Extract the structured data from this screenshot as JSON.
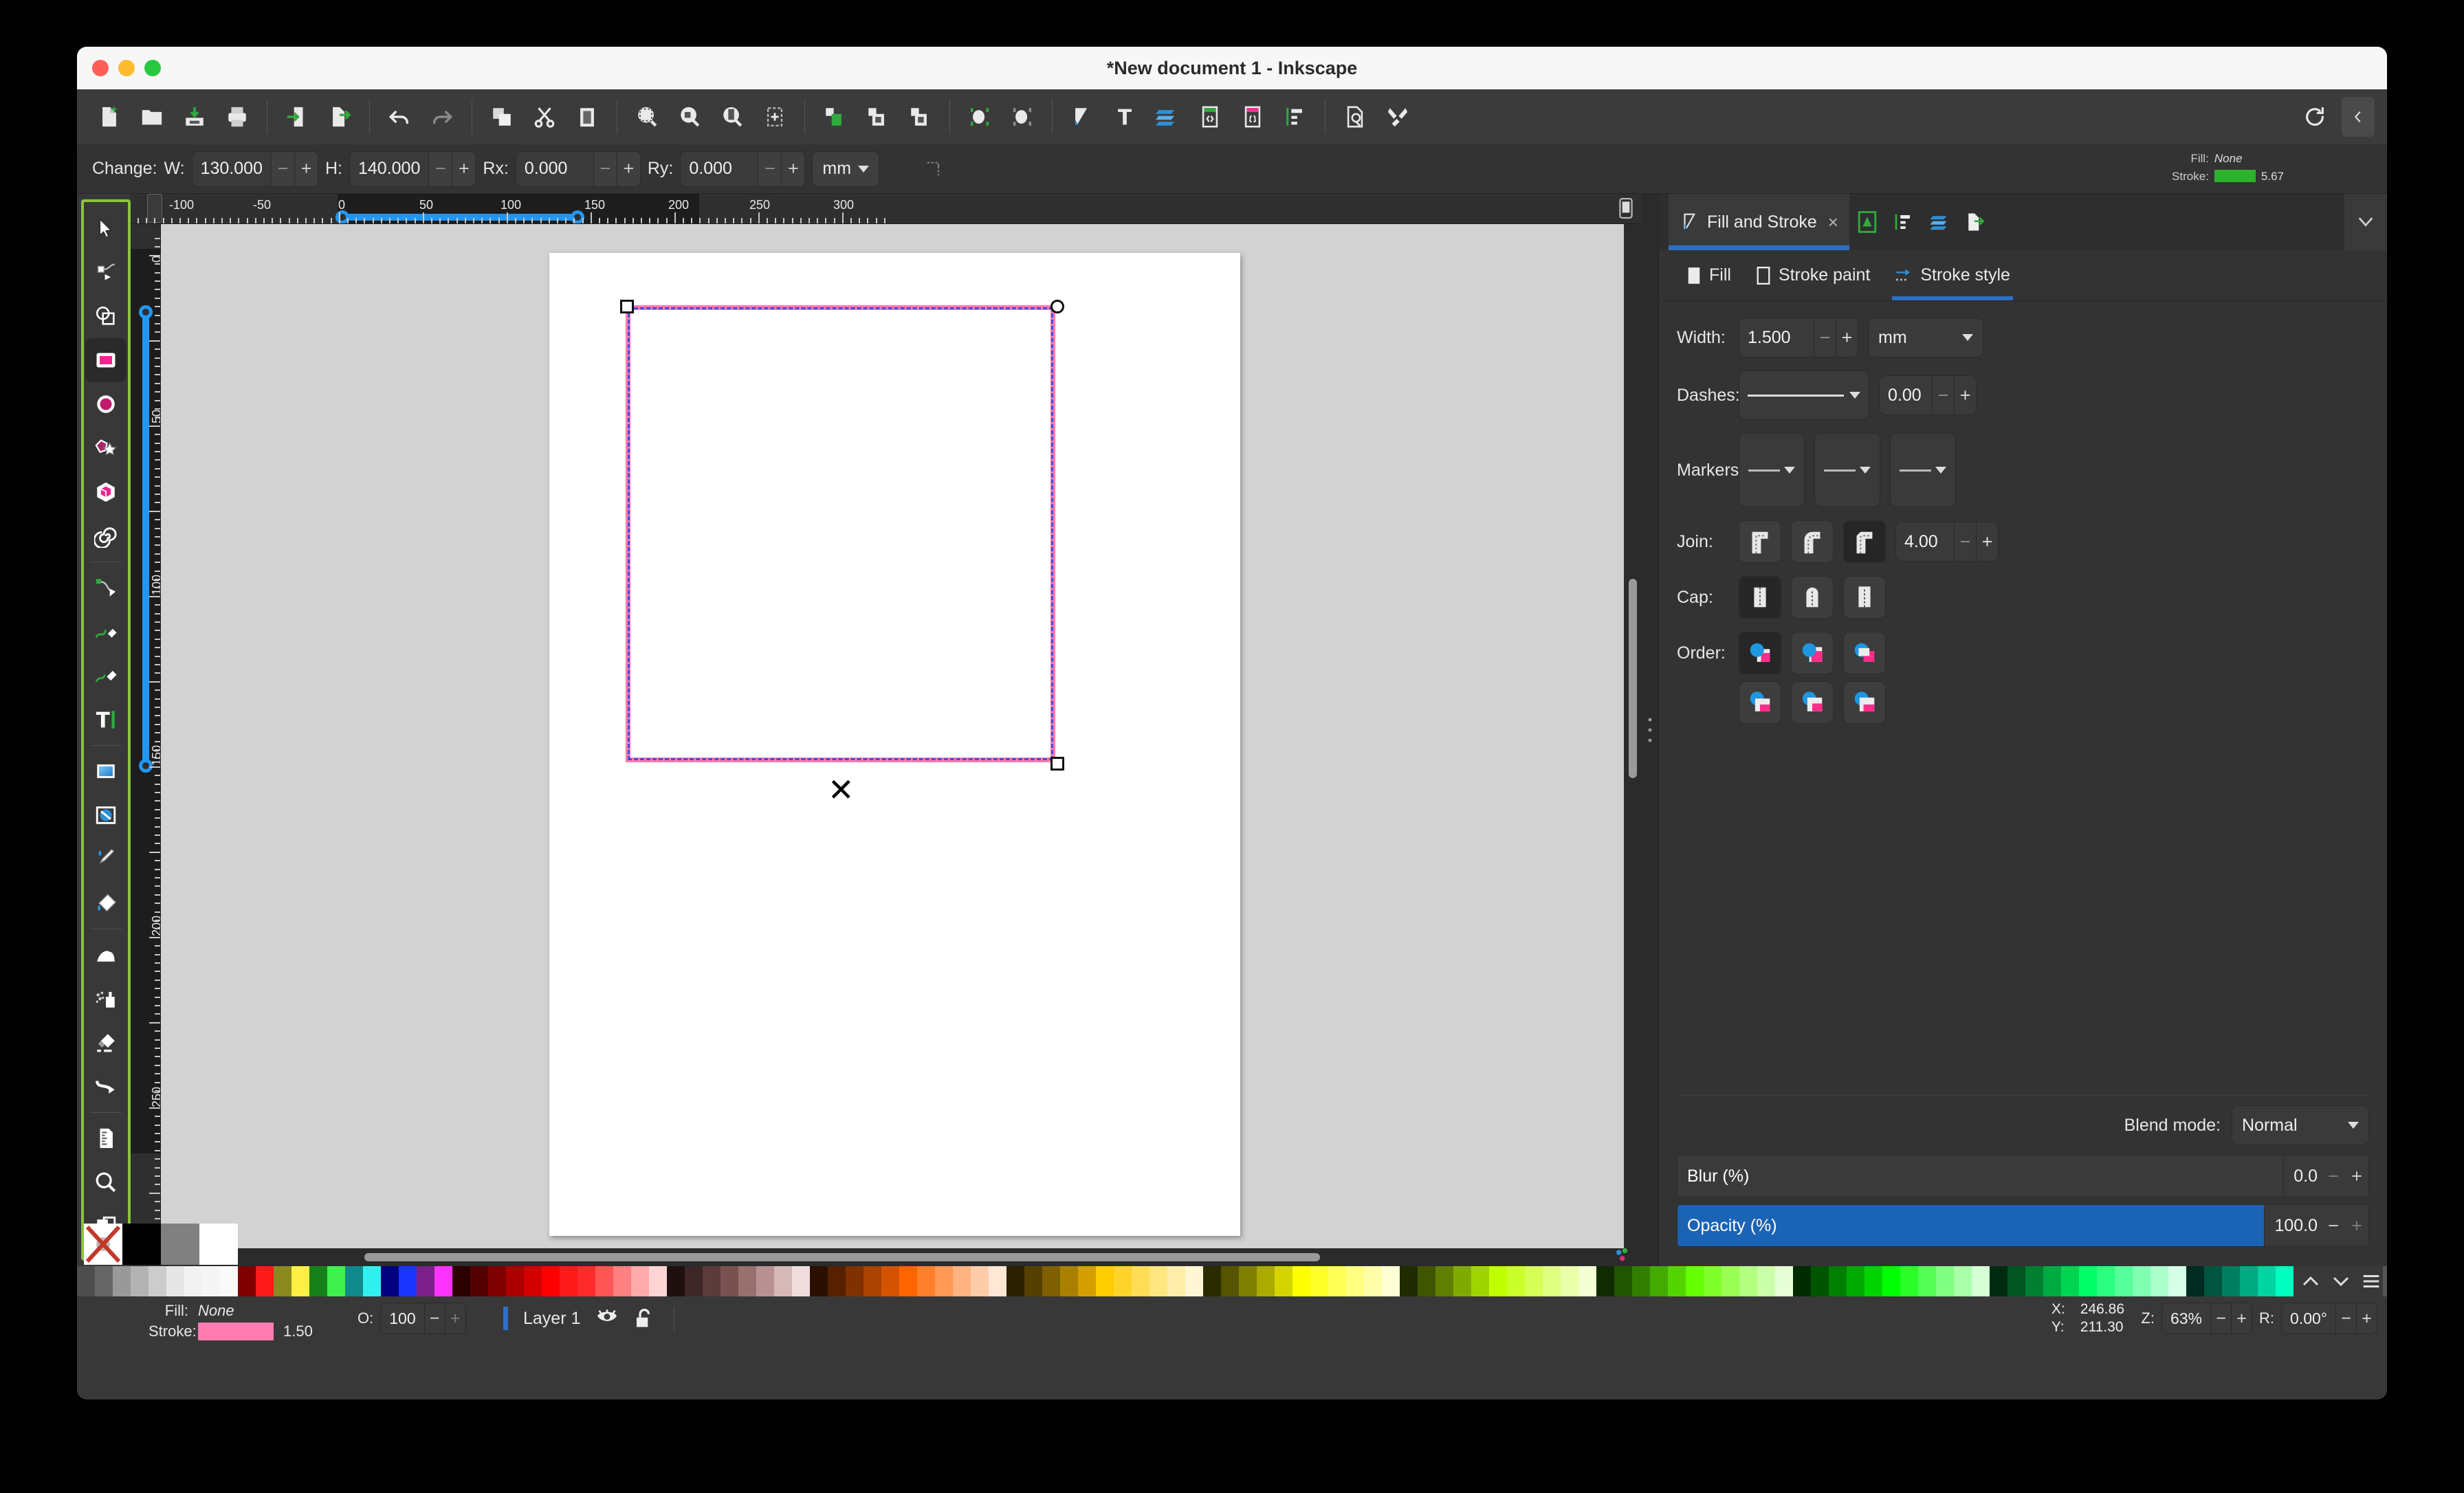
{
  "window": {
    "title": "*New document 1 - Inkscape",
    "traffic_lights": [
      "close",
      "minimize",
      "maximize"
    ]
  },
  "toolbar_main": {
    "buttons": [
      {
        "name": "new-document",
        "icon": "new-doc-icon"
      },
      {
        "name": "open-document",
        "icon": "open-folder-icon"
      },
      {
        "name": "save-document",
        "icon": "save-icon"
      },
      {
        "name": "print-document",
        "icon": "print-icon"
      },
      {
        "name": "import",
        "icon": "import-icon"
      },
      {
        "name": "export",
        "icon": "export-icon"
      },
      {
        "name": "undo",
        "icon": "undo-icon"
      },
      {
        "name": "redo",
        "icon": "redo-icon"
      },
      {
        "name": "copy",
        "icon": "copy-icon"
      },
      {
        "name": "cut",
        "icon": "scissors-icon"
      },
      {
        "name": "paste",
        "icon": "clipboard-icon"
      },
      {
        "name": "zoom-selection",
        "icon": "zoom-selection-icon"
      },
      {
        "name": "zoom-drawing",
        "icon": "zoom-drawing-icon"
      },
      {
        "name": "zoom-page",
        "icon": "zoom-page-icon"
      },
      {
        "name": "zoom-center-page",
        "icon": "zoom-center-icon"
      },
      {
        "name": "duplicate-group",
        "icon": "group-icon"
      },
      {
        "name": "group-objects",
        "icon": "group-objects-icon"
      },
      {
        "name": "ungroup-objects",
        "icon": "ungroup-objects-icon"
      },
      {
        "name": "clip-set",
        "icon": "clip-icon"
      },
      {
        "name": "mask-set",
        "icon": "mask-icon"
      },
      {
        "name": "fill-and-stroke-dialog",
        "icon": "fill-stroke-icon"
      },
      {
        "name": "text-and-font-dialog",
        "icon": "text-icon"
      },
      {
        "name": "layers-dialog",
        "icon": "layers-icon"
      },
      {
        "name": "xml-editor",
        "icon": "xml-editor-icon"
      },
      {
        "name": "selectors-dialog",
        "icon": "selectors-icon"
      },
      {
        "name": "objects-dialog",
        "icon": "objects-list-icon"
      },
      {
        "name": "document-properties",
        "icon": "doc-properties-icon"
      },
      {
        "name": "preferences",
        "icon": "preferences-wrench-icon"
      }
    ],
    "reset_label": "reset-icon",
    "collapse_label": "collapse-panel-icon"
  },
  "tool_options": {
    "change_label": "Change:",
    "w_label": "W:",
    "w_value": "130.000",
    "h_label": "H:",
    "h_value": "140.000",
    "rx_label": "Rx:",
    "rx_value": "0.000",
    "ry_label": "Ry:",
    "ry_value": "0.000",
    "unit": "mm",
    "sharp_corners_icon": "make-corners-sharp-icon"
  },
  "indicator_top_right": {
    "fill_label": "Fill:",
    "fill_value": "None",
    "stroke_label": "Stroke:",
    "stroke_color": "#2bb32b",
    "stroke_width": "5.67"
  },
  "toolbox": {
    "tools": [
      {
        "name": "selector-tool",
        "icon": "arrow-cursor-icon",
        "active": false
      },
      {
        "name": "node-tool",
        "icon": "node-editor-icon",
        "active": false
      },
      {
        "name": "boolean-tool",
        "icon": "boolean-ops-icon",
        "active": false
      },
      {
        "name": "rectangle-tool",
        "icon": "rectangle-icon",
        "active": true
      },
      {
        "name": "ellipse-tool",
        "icon": "ellipse-icon",
        "active": false
      },
      {
        "name": "star-tool",
        "icon": "star-polygon-icon",
        "active": false
      },
      {
        "name": "box3d-tool",
        "icon": "cube-3d-icon",
        "active": false
      },
      {
        "name": "spiral-tool",
        "icon": "spiral-icon",
        "active": false
      },
      {
        "name": "pen-tool",
        "icon": "bezier-pen-icon",
        "active": false
      },
      {
        "name": "pencil-tool",
        "icon": "pencil-icon",
        "active": false
      },
      {
        "name": "calligraphy-tool",
        "icon": "calligraphy-brush-icon",
        "active": false
      },
      {
        "name": "text-tool",
        "icon": "text-a-icon",
        "active": false
      },
      {
        "name": "gradient-tool",
        "icon": "gradient-icon",
        "active": false
      },
      {
        "name": "mesh-gradient-tool",
        "icon": "mesh-gradient-icon",
        "active": false
      },
      {
        "name": "dropper-tool",
        "icon": "eyedropper-icon",
        "active": false
      },
      {
        "name": "paint-bucket-tool",
        "icon": "paint-bucket-icon",
        "active": false
      },
      {
        "name": "tweak-tool",
        "icon": "tweak-hand-icon",
        "active": false
      },
      {
        "name": "spray-tool",
        "icon": "spray-can-icon",
        "active": false
      },
      {
        "name": "eraser-tool",
        "icon": "eraser-icon",
        "active": false
      },
      {
        "name": "connector-tool",
        "icon": "connector-arrow-icon",
        "active": false
      },
      {
        "name": "measure-tool",
        "icon": "measure-ruler-icon",
        "active": false
      },
      {
        "name": "zoom-tool",
        "icon": "magnifier-icon",
        "active": false
      },
      {
        "name": "pages-tool",
        "icon": "pages-icon",
        "active": false
      }
    ]
  },
  "rulers": {
    "unit": "mm",
    "horizontal_labels": [
      "-100",
      "-50",
      "0",
      "50",
      "100",
      "150",
      "200",
      "250",
      "300"
    ],
    "vertical_labels": [
      "0",
      "50",
      "100",
      "150",
      "200",
      "250"
    ],
    "selection_span_h": [
      "0",
      "150"
    ],
    "selection_span_v": [
      "0",
      "160"
    ]
  },
  "dock": {
    "tabs": [
      {
        "name": "fill-and-stroke",
        "label": "Fill and Stroke",
        "icon": "fill-stroke-icon",
        "active": true,
        "closable": true
      },
      {
        "name": "symbols",
        "icon": "symbols-icon",
        "active": false
      },
      {
        "name": "objects",
        "icon": "objects-list-icon",
        "active": false
      },
      {
        "name": "layers",
        "icon": "layers-icon",
        "active": false
      },
      {
        "name": "export",
        "icon": "export-icon",
        "active": false
      }
    ],
    "close_label": "×",
    "chevron_icon": "chevron-down-icon",
    "subtabs": [
      {
        "name": "tab-fill",
        "label": "Fill",
        "icon": "fill-square-icon",
        "active": false
      },
      {
        "name": "tab-stroke-paint",
        "label": "Stroke paint",
        "icon": "stroke-paint-icon",
        "active": false
      },
      {
        "name": "tab-stroke-style",
        "label": "Stroke style",
        "icon": "stroke-style-icon",
        "active": true
      }
    ],
    "stroke_style": {
      "width_label": "Width:",
      "width_value": "1.500",
      "width_unit": "mm",
      "dashes_label": "Dashes:",
      "dash_offset": "0.00",
      "markers_label": "Markers:",
      "markers": [
        "none",
        "none",
        "none"
      ],
      "join_label": "Join:",
      "join_options": [
        "miter-join",
        "round-join",
        "bevel-join"
      ],
      "join_selected_index": 2,
      "miter_limit": "4.00",
      "cap_label": "Cap:",
      "cap_options": [
        "butt-cap",
        "round-cap",
        "square-cap"
      ],
      "cap_selected_index": 0,
      "order_label": "Order:",
      "order_options": [
        "fill-stroke-markers",
        "fill-markers-stroke",
        "stroke-fill-markers",
        "stroke-markers-fill",
        "markers-fill-stroke",
        "markers-stroke-fill"
      ],
      "order_selected_index": 0
    },
    "blend_mode_label": "Blend mode:",
    "blend_mode_value": "Normal",
    "blur_label": "Blur (%)",
    "blur_value": "0.0",
    "opacity_label": "Opacity (%)",
    "opacity_value": "100.0",
    "opacity_percent": 100
  },
  "statusbar": {
    "fill_label": "Fill:",
    "fill_value": "None",
    "stroke_label": "Stroke:",
    "stroke_color": "#ff7bb0",
    "stroke_width": "1.50",
    "opacity_label": "O:",
    "opacity_value": "100",
    "layer_name": "Layer 1",
    "layer_visibility_icon": "eye-icon",
    "layer_lock_icon": "unlock-icon",
    "x_label": "X:",
    "x_value": "246.86",
    "y_label": "Y:",
    "y_value": "211.30",
    "zoom_label": "Z:",
    "zoom_value": "63%",
    "rotation_label": "R:",
    "rotation_value": "0.00°",
    "menu_icon": "hamburger-menu-icon",
    "palette_up_icon": "chevron-up-icon",
    "palette_down_icon": "chevron-down-icon",
    "snap_icon": "snap-controls-icon"
  },
  "palette": {
    "quick": [
      "none",
      "#000000",
      "#808080",
      "#ffffff"
    ],
    "colors": [
      "#4d4d4d",
      "#666666",
      "#999999",
      "#b3b3b3",
      "#cccccc",
      "#e6e6e6",
      "#f2f2f2",
      "#f5f5f5",
      "#fafafa",
      "#800000",
      "#ff1a1a",
      "#8a8a1f",
      "#ffee44",
      "#15801a",
      "#3ff04f",
      "#0f8a8a",
      "#33f0f0",
      "#000080",
      "#1a35ff",
      "#7d1f8a",
      "#ff33ff",
      "#2b0000",
      "#550000",
      "#7f0000",
      "#aa0000",
      "#d40000",
      "#ff0000",
      "#ff1a1a",
      "#ff2b2b",
      "#ff5555",
      "#ff8080",
      "#ffaaaa",
      "#ffd4d4",
      "#1f0f0f",
      "#3d2626",
      "#5c3b3b",
      "#7a5151",
      "#997070",
      "#b89292",
      "#d6b8b8",
      "#f0dede",
      "#2b1000",
      "#552100",
      "#7f3200",
      "#aa4200",
      "#d45300",
      "#ff6400",
      "#ff7f2a",
      "#ff9955",
      "#ffb380",
      "#ffccaa",
      "#ffe6d5",
      "#2b2000",
      "#554000",
      "#7f6000",
      "#aa8000",
      "#d4a000",
      "#ffcc00",
      "#ffd42a",
      "#ffdd55",
      "#ffe680",
      "#ffeeaa",
      "#fff6d5",
      "#2b2b00",
      "#555500",
      "#7f7f00",
      "#aaaa00",
      "#d4d400",
      "#ffff00",
      "#ffff2a",
      "#ffff55",
      "#ffff80",
      "#ffffaa",
      "#ffffd5",
      "#202b00",
      "#405500",
      "#607f00",
      "#80aa00",
      "#a0d400",
      "#c0ff00",
      "#caff2a",
      "#d5ff55",
      "#dfff80",
      "#eaffaa",
      "#f4ffd5",
      "#102b00",
      "#215500",
      "#327f00",
      "#42aa00",
      "#53d400",
      "#64ff00",
      "#7fff2a",
      "#99ff55",
      "#b3ff80",
      "#ccffaa",
      "#e6ffd5",
      "#002b00",
      "#005500",
      "#007f00",
      "#00aa00",
      "#00d400",
      "#00ff00",
      "#2aff2a",
      "#55ff55",
      "#80ff80",
      "#aaffaa",
      "#d5ffd5",
      "#002b10",
      "#005521",
      "#007f32",
      "#00aa42",
      "#00d453",
      "#00ff64",
      "#2aff7f",
      "#55ff99",
      "#80ffb3",
      "#aaffcc",
      "#d5ffe6",
      "#002b20",
      "#005540",
      "#007f60",
      "#00aa80",
      "#00d4a0",
      "#00ffc0",
      "#2affca",
      "#55ffd5",
      "#80ffdf",
      "#aaffea",
      "#3a3a3a",
      "#555555",
      "#707070",
      "#8b8b8b",
      "#a6a6a6",
      "#c1c1c1",
      "#dcdcdc",
      "#1a1a00",
      "#333300",
      "#4d4d00",
      "#666600",
      "#808000",
      "#999900",
      "#b3b300",
      "#cccc00",
      "#e6e600",
      "#ffff33",
      "#ffff66"
    ]
  }
}
